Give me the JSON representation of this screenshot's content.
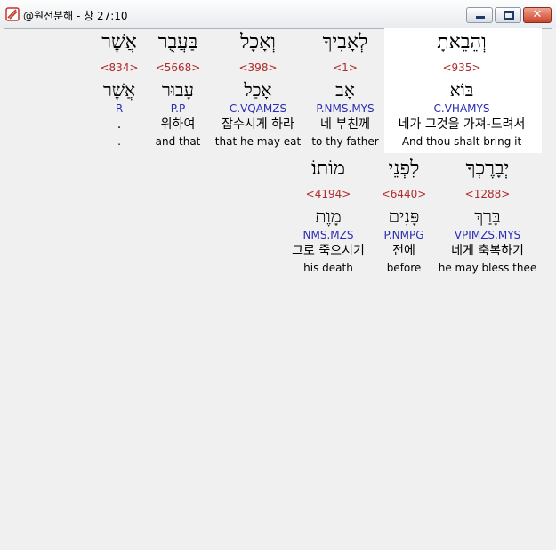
{
  "window": {
    "title": "@원전분해 - 창 27:10",
    "minimize_symbol": "",
    "maximize_symbol": "",
    "close_symbol": "✕"
  },
  "words": [
    {
      "hebrew": "וְהֵבֵאתָ",
      "strong": "<935>",
      "root": "בּוֹא",
      "parse": "C.VHAMYS",
      "korean": "네가 그것을 가져-드려서",
      "english": "And thou shalt bring it",
      "highlighted": true
    },
    {
      "hebrew": "לְאָבִיךָ",
      "strong": "<1>",
      "root": "אָב",
      "parse": "P.NMS.MYS",
      "korean": "네 부친께",
      "english": "to thy father"
    },
    {
      "hebrew": "וְאָכָל",
      "strong": "<398>",
      "root": "אָכַל",
      "parse": "C.VQAMZS",
      "korean": "잡수시게 하라",
      "english": "that he may eat"
    },
    {
      "hebrew": "בַּעֲבֻר",
      "strong": "<5668>",
      "root": "עָבוּר",
      "parse": "P.P",
      "korean": "위하여",
      "english": "and that"
    },
    {
      "hebrew": "אֲשֶׁר",
      "strong": "<834>",
      "root": "אֲשֶׁר",
      "parse": "R",
      "korean": ".",
      "english": "."
    },
    {
      "hebrew": "יְבָרֶכְךָ",
      "strong": "<1288>",
      "root": "בָּרַךְ",
      "parse": "VPIMZS.MYS",
      "korean": "네게 축복하기",
      "english": "he may bless thee"
    },
    {
      "hebrew": "לִפְנֵי",
      "strong": "<6440>",
      "root": "פָּנִים",
      "parse": "P.NMPG",
      "korean": "전에",
      "english": "before"
    },
    {
      "hebrew": "מוֹתוֹ׃",
      "strong": "<4194>",
      "root": "מָוֶת",
      "parse": "NMS.MZS",
      "korean": "그로 죽으시기",
      "english": "his death"
    }
  ]
}
